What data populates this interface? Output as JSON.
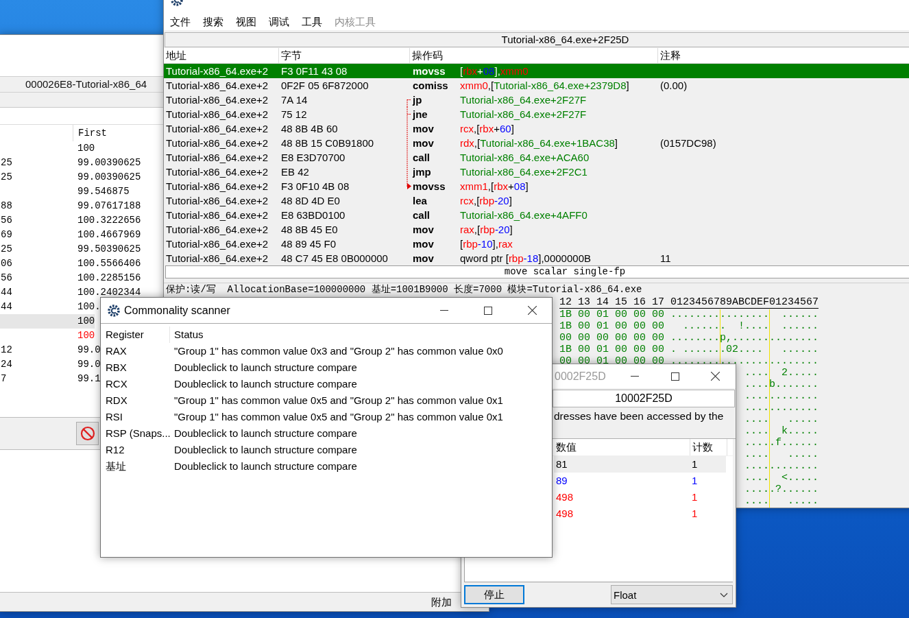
{
  "main_window": {
    "process_label": "000026E8-Tutorial-x86_64",
    "header": "First",
    "rows": [
      {
        "column_1": "",
        "first": "100",
        "selected": false,
        "changed": false
      },
      {
        "column_1": "25",
        "first": "99.00390625",
        "selected": false,
        "changed": false
      },
      {
        "column_1": "25",
        "first": "99.00390625",
        "selected": false,
        "changed": false
      },
      {
        "column_1": "",
        "first": "99.546875",
        "selected": false,
        "changed": false
      },
      {
        "column_1": "88",
        "first": "99.07617188",
        "selected": false,
        "changed": false
      },
      {
        "column_1": "56",
        "first": "100.3222656",
        "selected": false,
        "changed": false
      },
      {
        "column_1": "69",
        "first": "100.4667969",
        "selected": false,
        "changed": false
      },
      {
        "column_1": "25",
        "first": "99.50390625",
        "selected": false,
        "changed": false
      },
      {
        "column_1": "06",
        "first": "100.5566406",
        "selected": false,
        "changed": false
      },
      {
        "column_1": "56",
        "first": "100.2285156",
        "selected": false,
        "changed": false
      },
      {
        "column_1": "44",
        "first": "100.2402344",
        "selected": false,
        "changed": false
      },
      {
        "column_1": "44",
        "first": "100.",
        "selected": false,
        "changed": false
      },
      {
        "column_1": "",
        "first": "100",
        "selected": true,
        "changed": false
      },
      {
        "column_1": "",
        "first": "100",
        "selected": false,
        "changed": true
      },
      {
        "column_1": "12",
        "first": "99.0",
        "selected": false,
        "changed": false
      },
      {
        "column_1": "24",
        "first": "99.0",
        "selected": false,
        "changed": false
      },
      {
        "column_1": "7",
        "first": "99.1",
        "selected": false,
        "changed": false
      }
    ],
    "status_text": "附加"
  },
  "memory_viewer": {
    "menu": [
      {
        "label": "文件",
        "disabled": false
      },
      {
        "label": "搜索",
        "disabled": false
      },
      {
        "label": "视图",
        "disabled": false
      },
      {
        "label": "调试",
        "disabled": false
      },
      {
        "label": "工具",
        "disabled": false
      },
      {
        "label": "内核工具",
        "disabled": true
      }
    ],
    "address": "Tutorial-x86_64.exe+2F25D",
    "columns": [
      "地址",
      "字节",
      "操作码",
      "注释"
    ],
    "rows": [
      {
        "address": "Tutorial-x86_64.exe+2",
        "bytes": "F3 0F11 43 08",
        "opcode": "movss",
        "operands": [
          {
            "text": "[",
            "kind": "plain"
          },
          {
            "text": "rbx",
            "kind": "reg"
          },
          {
            "text": "+",
            "kind": "plain"
          },
          {
            "text": "08",
            "kind": "num"
          },
          {
            "text": "],",
            "kind": "plain"
          },
          {
            "text": "xmm0",
            "kind": "reg"
          }
        ],
        "comment": "",
        "selected": true,
        "jump_from": false,
        "jump_to": false
      },
      {
        "address": "Tutorial-x86_64.exe+2",
        "bytes": "0F2F 05 6F872000",
        "opcode": "comiss",
        "operands": [
          {
            "text": "xmm0",
            "kind": "reg"
          },
          {
            "text": ",[",
            "kind": "plain"
          },
          {
            "text": "Tutorial-x86_64.exe+2379D8",
            "kind": "addr"
          },
          {
            "text": "]",
            "kind": "plain"
          }
        ],
        "comment": "(0.00)",
        "selected": false,
        "jump_from": false,
        "jump_to": false
      },
      {
        "address": "Tutorial-x86_64.exe+2",
        "bytes": "7A 14",
        "opcode": "jp",
        "operands": [
          {
            "text": "Tutorial-x86_64.exe+2F27F",
            "kind": "addr"
          }
        ],
        "comment": "",
        "selected": false,
        "jump_from": true,
        "jump_to": false
      },
      {
        "address": "Tutorial-x86_64.exe+2",
        "bytes": "75 12",
        "opcode": "jne",
        "operands": [
          {
            "text": "Tutorial-x86_64.exe+2F27F",
            "kind": "addr"
          }
        ],
        "comment": "",
        "selected": false,
        "jump_from": true,
        "jump_to": false
      },
      {
        "address": "Tutorial-x86_64.exe+2",
        "bytes": "48 8B 4B 60",
        "opcode": "mov",
        "operands": [
          {
            "text": "rcx",
            "kind": "reg"
          },
          {
            "text": ",[",
            "kind": "plain"
          },
          {
            "text": "rbx",
            "kind": "reg"
          },
          {
            "text": "+",
            "kind": "plain"
          },
          {
            "text": "60",
            "kind": "num"
          },
          {
            "text": "]",
            "kind": "plain"
          }
        ],
        "comment": "",
        "selected": false,
        "jump_from": false,
        "jump_to": false
      },
      {
        "address": "Tutorial-x86_64.exe+2",
        "bytes": "48 8B 15 C0B91800",
        "opcode": "mov",
        "operands": [
          {
            "text": "rdx",
            "kind": "reg"
          },
          {
            "text": ",[",
            "kind": "plain"
          },
          {
            "text": "Tutorial-x86_64.exe+1BAC38",
            "kind": "addr"
          },
          {
            "text": "]",
            "kind": "plain"
          }
        ],
        "comment": "(0157DC98)",
        "selected": false,
        "jump_from": false,
        "jump_to": false
      },
      {
        "address": "Tutorial-x86_64.exe+2",
        "bytes": "E8 E3D70700",
        "opcode": "call",
        "operands": [
          {
            "text": "Tutorial-x86_64.exe+ACA60",
            "kind": "addr"
          }
        ],
        "comment": "",
        "selected": false,
        "jump_from": false,
        "jump_to": false
      },
      {
        "address": "Tutorial-x86_64.exe+2",
        "bytes": "EB 42",
        "opcode": "jmp",
        "operands": [
          {
            "text": "Tutorial-x86_64.exe+2F2C1",
            "kind": "addr"
          }
        ],
        "comment": "",
        "selected": false,
        "jump_from": false,
        "jump_to": false
      },
      {
        "address": "Tutorial-x86_64.exe+2",
        "bytes": "F3 0F10 4B 08",
        "opcode": "movss",
        "operands": [
          {
            "text": "xmm1",
            "kind": "reg"
          },
          {
            "text": ",[",
            "kind": "plain"
          },
          {
            "text": "rbx",
            "kind": "reg"
          },
          {
            "text": "+",
            "kind": "plain"
          },
          {
            "text": "08",
            "kind": "num"
          },
          {
            "text": "]",
            "kind": "plain"
          }
        ],
        "comment": "",
        "selected": false,
        "jump_from": false,
        "jump_to": true
      },
      {
        "address": "Tutorial-x86_64.exe+2",
        "bytes": "48 8D 4D E0",
        "opcode": "lea",
        "operands": [
          {
            "text": "rcx",
            "kind": "reg"
          },
          {
            "text": ",[",
            "kind": "plain"
          },
          {
            "text": "rbp",
            "kind": "reg"
          },
          {
            "text": "-20",
            "kind": "num"
          },
          {
            "text": "]",
            "kind": "plain"
          }
        ],
        "comment": "",
        "selected": false,
        "jump_from": false,
        "jump_to": false
      },
      {
        "address": "Tutorial-x86_64.exe+2",
        "bytes": "E8 63BD0100",
        "opcode": "call",
        "operands": [
          {
            "text": "Tutorial-x86_64.exe+4AFF0",
            "kind": "addr"
          }
        ],
        "comment": "",
        "selected": false,
        "jump_from": false,
        "jump_to": false
      },
      {
        "address": "Tutorial-x86_64.exe+2",
        "bytes": "48 8B 45 E0",
        "opcode": "mov",
        "operands": [
          {
            "text": "rax",
            "kind": "reg"
          },
          {
            "text": ",[",
            "kind": "plain"
          },
          {
            "text": "rbp",
            "kind": "reg"
          },
          {
            "text": "-20",
            "kind": "num"
          },
          {
            "text": "]",
            "kind": "plain"
          }
        ],
        "comment": "",
        "selected": false,
        "jump_from": false,
        "jump_to": false
      },
      {
        "address": "Tutorial-x86_64.exe+2",
        "bytes": "48 89 45 F0",
        "opcode": "mov",
        "operands": [
          {
            "text": "[",
            "kind": "plain"
          },
          {
            "text": "rbp",
            "kind": "reg"
          },
          {
            "text": "-10",
            "kind": "num"
          },
          {
            "text": "],",
            "kind": "plain"
          },
          {
            "text": "rax",
            "kind": "reg"
          }
        ],
        "comment": "",
        "selected": false,
        "jump_from": false,
        "jump_to": false
      },
      {
        "address": "Tutorial-x86_64.exe+2",
        "bytes": "48 C7 45 E8 0B000000",
        "opcode": "mov",
        "operands": [
          {
            "text": "qword ptr [",
            "kind": "plain"
          },
          {
            "text": "rbp",
            "kind": "reg"
          },
          {
            "text": "-18",
            "kind": "num"
          },
          {
            "text": "],0000000B",
            "kind": "plain"
          }
        ],
        "comment": "11",
        "selected": false,
        "jump_from": false,
        "jump_to": false
      }
    ],
    "description": "move scalar single-fp",
    "info": "保护:读/写  AllocationBase=100000000 基址=1001B9000 长度=7000 模块=Tutorial-x86_64.exe",
    "hex_header": "12 13 14 15 16 17 0123456789ABCDEF01234567",
    "hex_rows": [
      {
        "bytes": "1B 00 01 00 00 00",
        "ascii": "................  ......"
      },
      {
        "bytes": "1B 00 01 00 00 00",
        "ascii": "  .......  !....  ......"
      },
      {
        "bytes": "00 00 00 00 00 00",
        "ascii": "........p,.............."
      },
      {
        "bytes": "1B 00 01 00 00 00",
        "ascii": ". .......02....   ......"
      },
      {
        "bytes": "00 00 01 00 00 00",
        "ascii": "........................"
      },
      {
        "ascii_tail": "....  2....."
      },
      {
        "ascii_tail": "....b......."
      },
      {
        "ascii_tail": "............"
      },
      {
        "ascii_tail": "............"
      },
      {
        "ascii_tail": "....   ....."
      },
      {
        "ascii_tail": "....  k....."
      },
      {
        "ascii_tail": ".....f......"
      },
      {
        "ascii_tail": "....   ....."
      },
      {
        "ascii_tail": "............"
      },
      {
        "ascii_tail": "....  <....."
      },
      {
        "ascii_tail": ".....?......"
      },
      {
        "ascii_tail": "....   ....."
      }
    ]
  },
  "tracker": {
    "title": "0002F25D",
    "address": "10002F25D",
    "message": "dresses have been accessed by the",
    "columns": [
      "数值",
      "计数"
    ],
    "rows": [
      {
        "value": "81",
        "count": "1",
        "selected": true,
        "color": "#000000"
      },
      {
        "value": "89",
        "count": "1",
        "selected": false,
        "color": "#0000ff"
      },
      {
        "value": "498",
        "count": "1",
        "selected": false,
        "color": "#ff0000"
      },
      {
        "value": "498",
        "count": "1",
        "selected": false,
        "color": "#ff0000"
      }
    ],
    "stop_button": "停止",
    "type": "Float"
  },
  "commonality": {
    "title": "Commonality scanner",
    "columns": [
      "Register",
      "Status"
    ],
    "rows": [
      {
        "register": "RAX",
        "status": "\"Group 1\" has common value 0x3 and \"Group 2\" has common value 0x0"
      },
      {
        "register": "RBX",
        "status": "Doubleclick to launch structure compare"
      },
      {
        "register": "RCX",
        "status": "Doubleclick to launch structure compare"
      },
      {
        "register": "RDX",
        "status": "\"Group 1\" has common value 0x5 and \"Group 2\" has common value 0x1"
      },
      {
        "register": "RSI",
        "status": "\"Group 1\" has common value 0x5 and \"Group 2\" has common value 0x1"
      },
      {
        "register": "RSP (Snaps...",
        "status": "Doubleclick to launch structure compare"
      },
      {
        "register": "R12",
        "status": "Doubleclick to launch structure compare"
      },
      {
        "register": "基址",
        "status": "Doubleclick to launch structure compare"
      }
    ]
  }
}
